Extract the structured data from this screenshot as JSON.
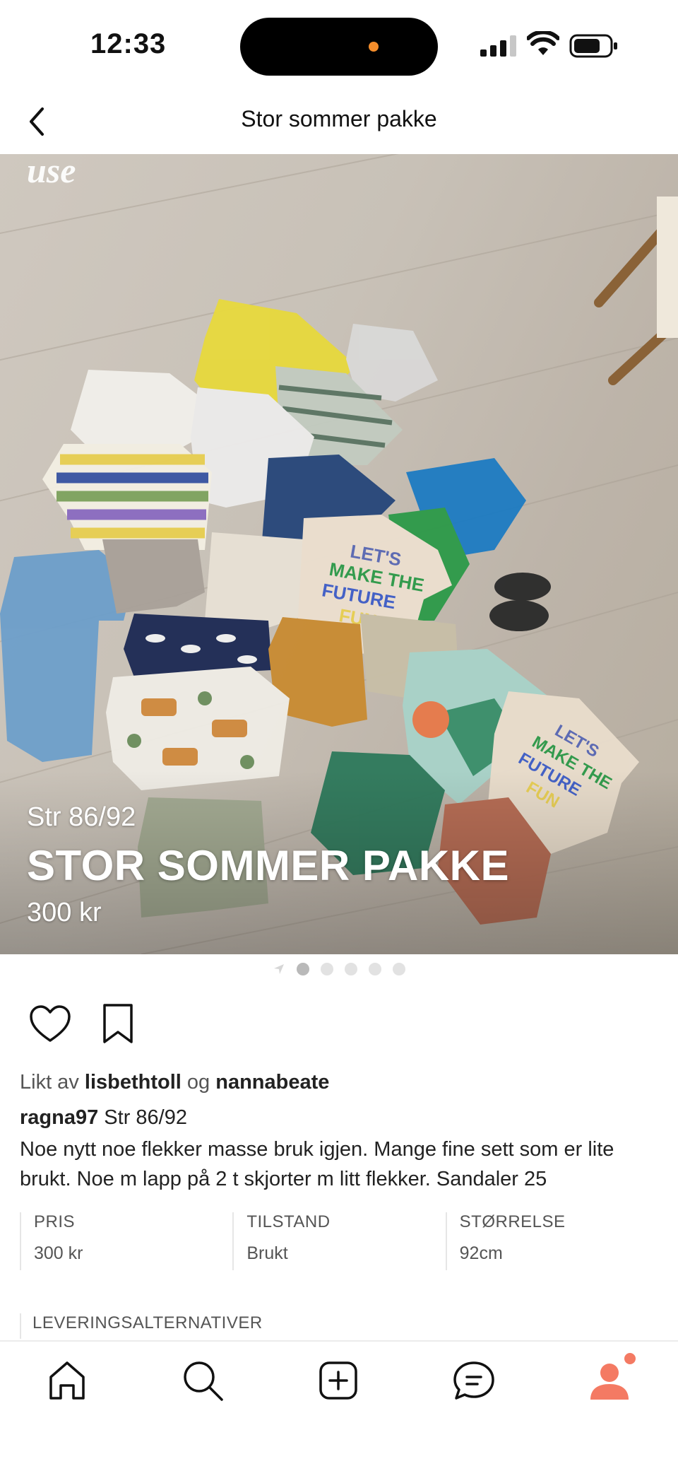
{
  "status_bar": {
    "time": "12:33"
  },
  "nav": {
    "title": "Stor sommer pakke"
  },
  "photo": {
    "watermark": "use",
    "size_text": "Str 86/92",
    "title_text": "STOR SOMMER PAKKE",
    "price_text": "300 kr",
    "page_count": 5,
    "current_page": 1
  },
  "likes": {
    "prefix": "Likt av",
    "user1": "lisbethtoll",
    "connector": "og",
    "user2": "nannabeate"
  },
  "listing": {
    "seller": "ragna97",
    "size_caption": "Str 86/92",
    "description": "Noe nytt noe flekker masse bruk igjen. Mange fine sett som er lite brukt. Noe m lapp på 2 t skjorter m litt flekker. Sandaler 25"
  },
  "attributes": [
    {
      "label": "PRIS",
      "value": "300 kr"
    },
    {
      "label": "TILSTAND",
      "value": "Brukt"
    },
    {
      "label": "STØRRELSE",
      "value": "92cm"
    }
  ],
  "delivery": {
    "label": "LEVERINGSALTERNATIVER"
  },
  "tab_bar": {
    "items": [
      {
        "name": "home",
        "icon": "home-icon"
      },
      {
        "name": "search",
        "icon": "search-icon"
      },
      {
        "name": "add",
        "icon": "plus-square-icon"
      },
      {
        "name": "messages",
        "icon": "chat-bubble-icon"
      },
      {
        "name": "profile",
        "icon": "person-icon",
        "has_notification": true
      }
    ]
  },
  "colors": {
    "accent": "#f47a63",
    "text": "#222222",
    "muted": "#555555"
  }
}
